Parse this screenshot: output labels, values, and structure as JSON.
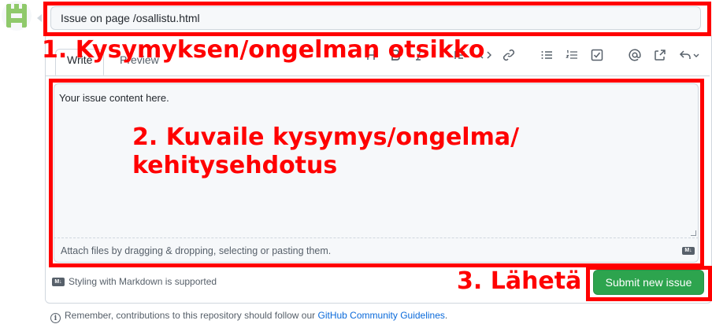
{
  "issue_form": {
    "title_value": "Issue on page /osallistu.html",
    "tabs": [
      "Write",
      "Preview"
    ],
    "body_placeholder": "Your issue content here.",
    "attach_hint": "Attach files by dragging & dropping, selecting or pasting them.",
    "markdown_note": "Styling with Markdown is supported",
    "submit_label": "Submit new issue",
    "footer_text": "Remember, contributions to this repository should follow our ",
    "footer_link": "GitHub Community Guidelines",
    "footer_end": "."
  },
  "toolbar_icons": [
    "heading-icon",
    "bold-icon",
    "italic-icon",
    "quote-icon",
    "code-icon",
    "link-icon",
    "bullet-list-icon",
    "numbered-list-icon",
    "task-list-icon",
    "mention-icon",
    "reference-icon",
    "reply-icon"
  ],
  "annotations": {
    "title": "1. Kysymyksen/ongelman otsikko",
    "describe_line1": "2. Kuvaile kysymys/ongelma/",
    "describe_line2": "kehitysehdotus",
    "send": "3. Lähetä"
  },
  "colors": {
    "annotation_red": "#ff0000",
    "submit_green": "#2da44e",
    "link_blue": "#0969da",
    "avatar_green": "#8fc96b"
  }
}
